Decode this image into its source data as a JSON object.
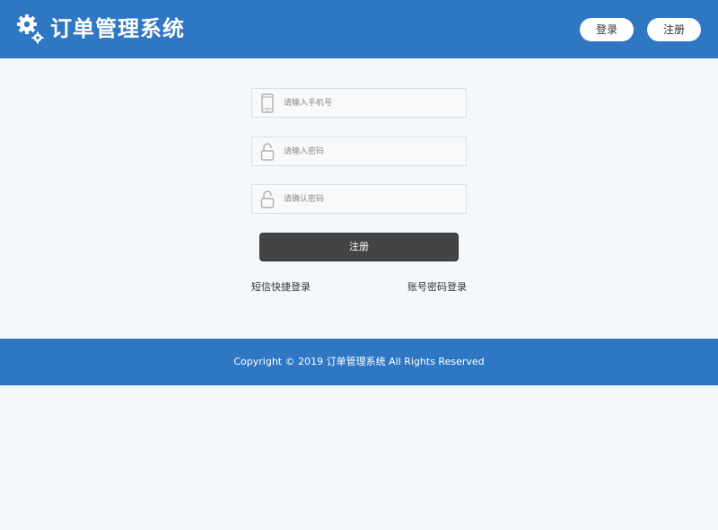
{
  "header": {
    "title": "订单管理系统",
    "logo_icon": "gears-icon",
    "login_label": "登录",
    "register_label": "注册"
  },
  "form": {
    "phone_placeholder": "请输入手机号",
    "password_placeholder": "请输入密码",
    "confirm_placeholder": "请确认密码",
    "phone_icon": "mobile-phone-icon",
    "lock_icon": "unlock-icon",
    "submit_label": "注册"
  },
  "links": {
    "sms_login": "短信快捷登录",
    "password_login": "账号密码登录"
  },
  "footer": {
    "copyright": "Copyright © 2019 订单管理系统 All Rights Reserved"
  },
  "colors": {
    "brand_blue": "#2f77c3",
    "page_background": "#f5f8fb",
    "button_dark": "#444444"
  }
}
